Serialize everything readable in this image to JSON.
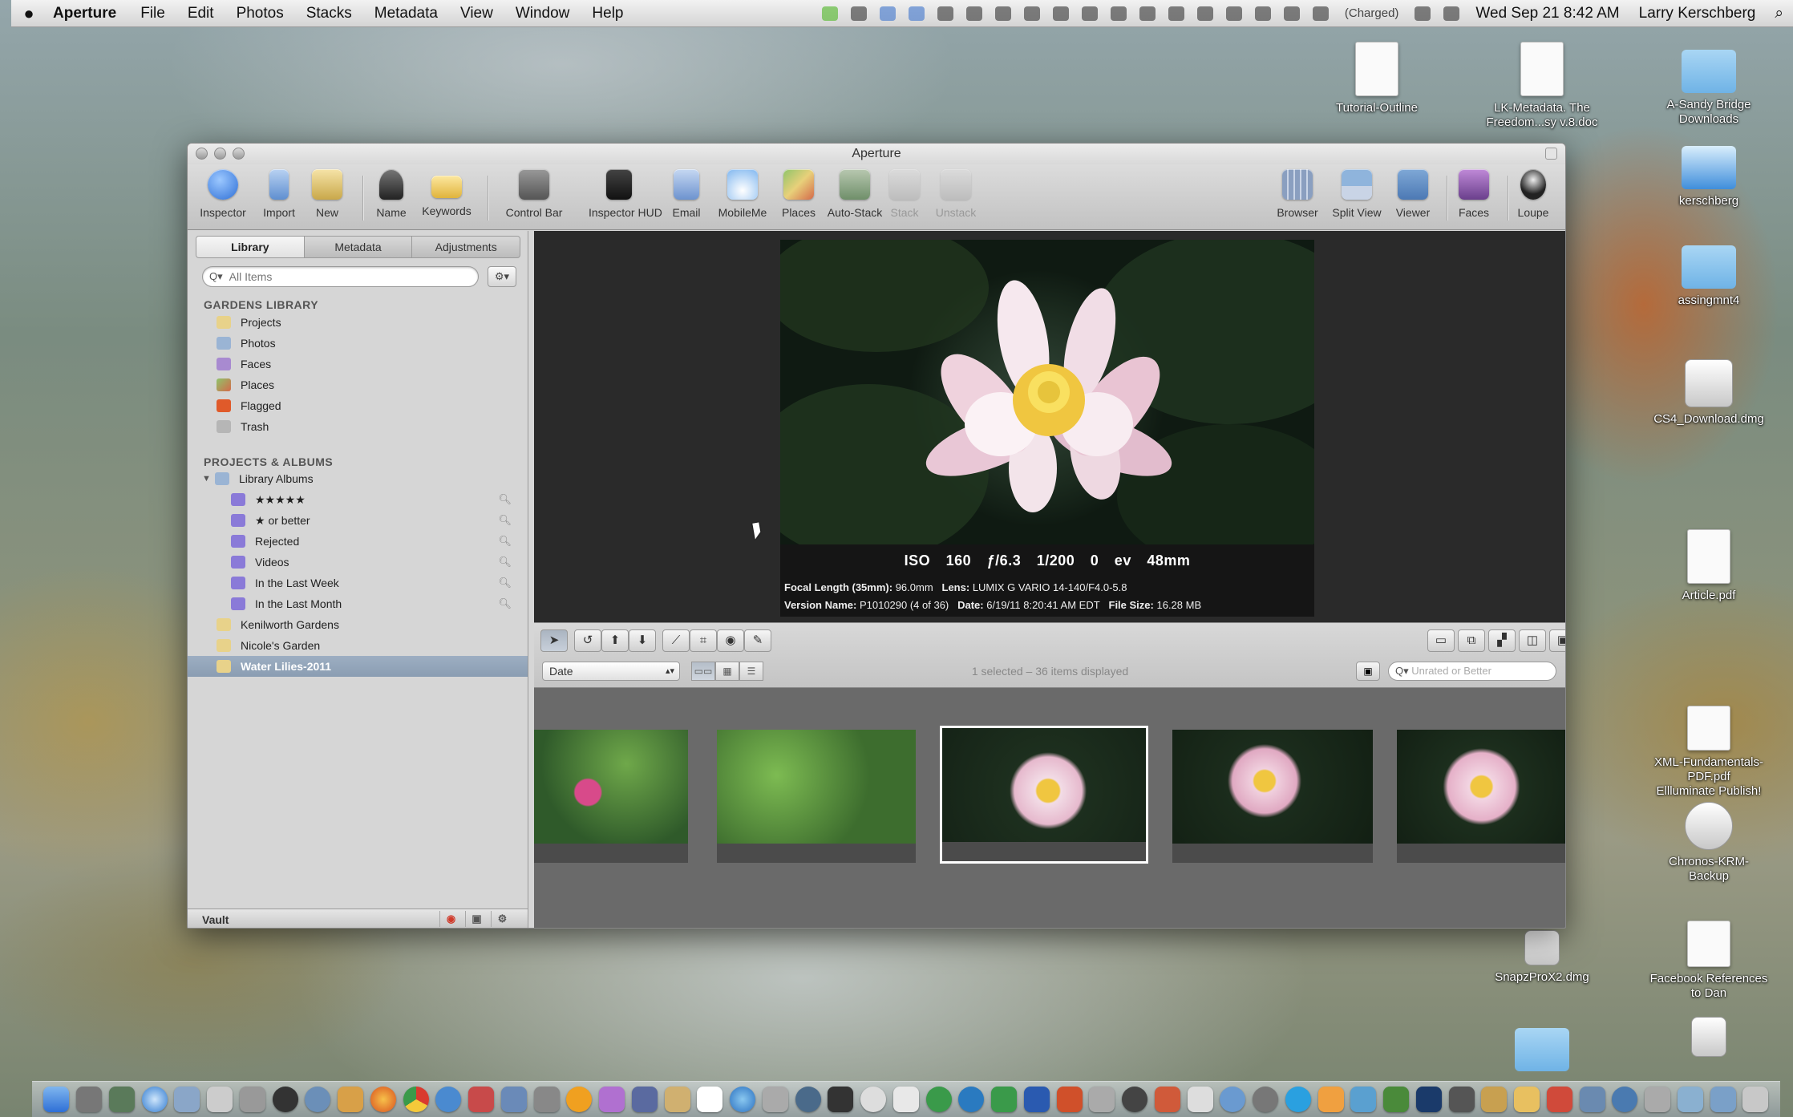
{
  "menubar": {
    "app_name": "Aperture",
    "items": [
      "File",
      "Edit",
      "Photos",
      "Stacks",
      "Metadata",
      "View",
      "Window",
      "Help"
    ],
    "battery": "(Charged)",
    "clock": "Wed Sep 21  8:42 AM",
    "user": "Larry Kerschberg"
  },
  "desktop": {
    "items": [
      {
        "label": "Tutorial-Outline"
      },
      {
        "label": "LK-Metadata. The\nFreedom...sy v.8.doc"
      },
      {
        "label": "A-Sandy Bridge\nDownloads"
      },
      {
        "label": "kerschberg"
      },
      {
        "label": "assingmnt4"
      },
      {
        "label": "CS4_Download.dmg"
      },
      {
        "label": "Article.pdf"
      },
      {
        "label": "XML-Fundamentals-\nPDF.pdf\nEllluminate Publish!"
      },
      {
        "label": "Chronos-KRM-\nBackup"
      },
      {
        "label": "SnapzProX2.dmg"
      },
      {
        "label": "Facebook References\nto Dan"
      }
    ]
  },
  "window": {
    "title": "Aperture"
  },
  "toolbar": {
    "inspector": "Inspector",
    "import": "Import",
    "new": "New",
    "name": "Name",
    "keywords": "Keywords",
    "control_bar": "Control Bar",
    "inspector_hud": "Inspector HUD",
    "email": "Email",
    "mobileme": "MobileMe",
    "places": "Places",
    "auto_stack": "Auto-Stack",
    "stack": "Stack",
    "unstack": "Unstack",
    "browser": "Browser",
    "split_view": "Split View",
    "viewer": "Viewer",
    "faces": "Faces",
    "loupe": "Loupe"
  },
  "sidebar": {
    "tabs": [
      "Library",
      "Metadata",
      "Adjustments"
    ],
    "search_placeholder": "All Items",
    "library_header": "GARDENS LIBRARY",
    "library_items": [
      "Projects",
      "Photos",
      "Faces",
      "Places",
      "Flagged",
      "Trash"
    ],
    "projects_header": "PROJECTS & ALBUMS",
    "library_albums": "Library Albums",
    "albums": [
      "★★★★★",
      "★ or better",
      "Rejected",
      "Videos",
      "In the Last Week",
      "In the Last Month"
    ],
    "projects": [
      "Kenilworth Gardens",
      "Nicole's Garden",
      "Water Lilies-2011"
    ],
    "vault": "Vault"
  },
  "viewer": {
    "iso": "ISO 160",
    "aperture": "ƒ/6.3",
    "shutter": "1/200",
    "exposure": "0 ev",
    "focal": "48mm",
    "focal_length_label": "Focal Length (35mm):",
    "focal_length_value": "96.0mm",
    "lens_label": "Lens:",
    "lens_value": "LUMIX G VARIO 14-140/F4.0-5.8",
    "version_label": "Version Name:",
    "version_value": "P1010290 (4 of 36)",
    "date_label": "Date:",
    "date_value": "6/19/11 8:20:41 AM EDT",
    "filesize_label": "File Size:",
    "filesize_value": "16.28 MB"
  },
  "controlbar": {
    "sort": "Date",
    "status": "1 selected – 36 items displayed",
    "filter_placeholder": "Unrated or Better"
  },
  "colors": {
    "selection": "#8a9db2",
    "viewer_bg": "#2a2a2a",
    "browser_bg": "#6a6a6a"
  }
}
